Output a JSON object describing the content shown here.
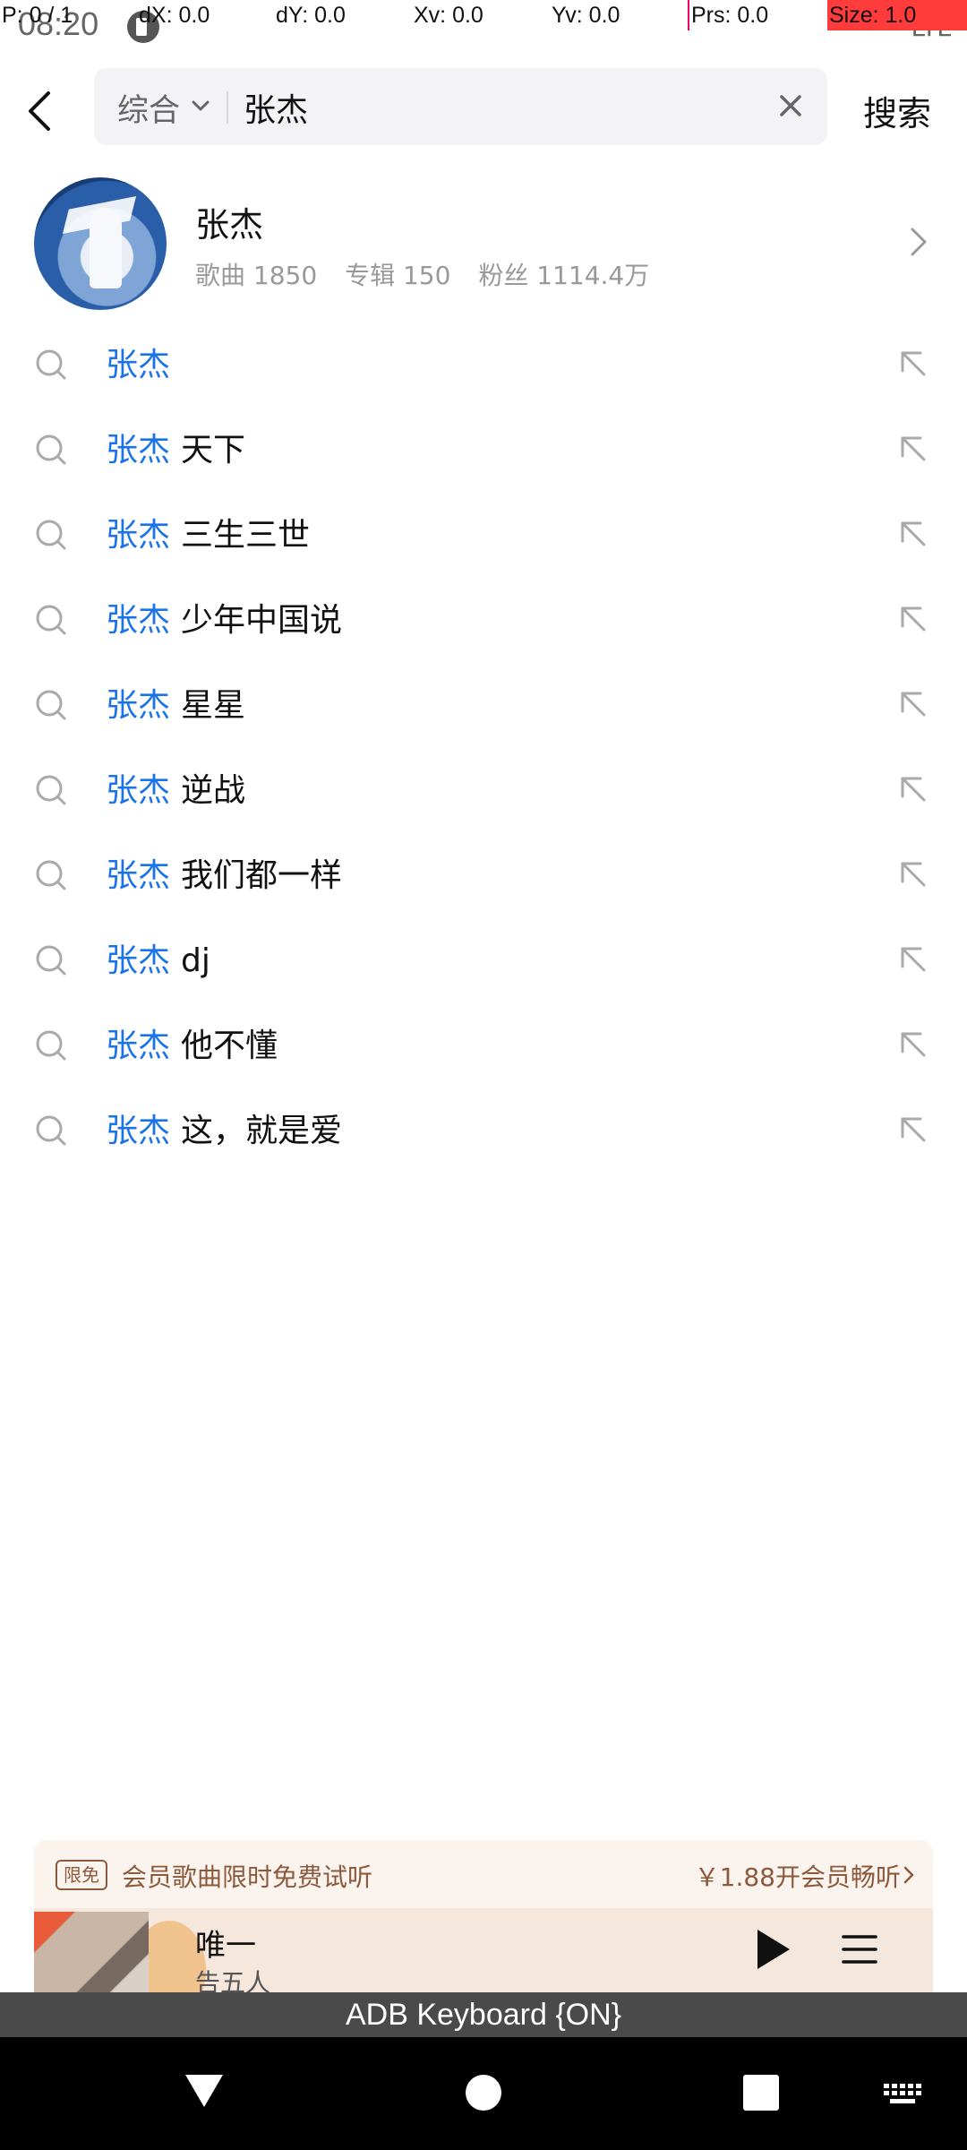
{
  "debug": {
    "pointer": "P: 0 / 1",
    "dx": "dX: 0.0",
    "dy": "dY: 0.0",
    "xv": "Xv: 0.0",
    "yv": "Yv: 0.0",
    "prs": "Prs: 0.0",
    "size": "Size: 1.0"
  },
  "status": {
    "time": "08:20",
    "network": "LTE"
  },
  "search": {
    "scope": "综合",
    "query": "张杰",
    "submit_label": "搜索"
  },
  "artist": {
    "name": "张杰",
    "songs": "歌曲 1850",
    "albums": "专辑 150",
    "fans": "粉丝 1114.4万"
  },
  "suggestions": [
    {
      "keyword": "张杰",
      "rest": ""
    },
    {
      "keyword": "张杰",
      "rest": "天下"
    },
    {
      "keyword": "张杰",
      "rest": "三生三世"
    },
    {
      "keyword": "张杰",
      "rest": "少年中国说"
    },
    {
      "keyword": "张杰",
      "rest": "星星"
    },
    {
      "keyword": "张杰",
      "rest": "逆战"
    },
    {
      "keyword": "张杰",
      "rest": "我们都一样"
    },
    {
      "keyword": "张杰",
      "rest": "dj"
    },
    {
      "keyword": "张杰",
      "rest": "他不懂"
    },
    {
      "keyword": "张杰",
      "rest": "这，就是爱"
    }
  ],
  "promo": {
    "badge": "限免",
    "text": "会员歌曲限时免费试听",
    "cta": "￥1.88开会员畅听"
  },
  "player": {
    "title": "唯一",
    "artist": "告五人"
  },
  "ime": {
    "label": "ADB Keyboard {ON}"
  },
  "colors": {
    "keyword": "#1a73e8",
    "promo_text": "#8b5a3c",
    "promo_bg": "#fbf3ed"
  }
}
